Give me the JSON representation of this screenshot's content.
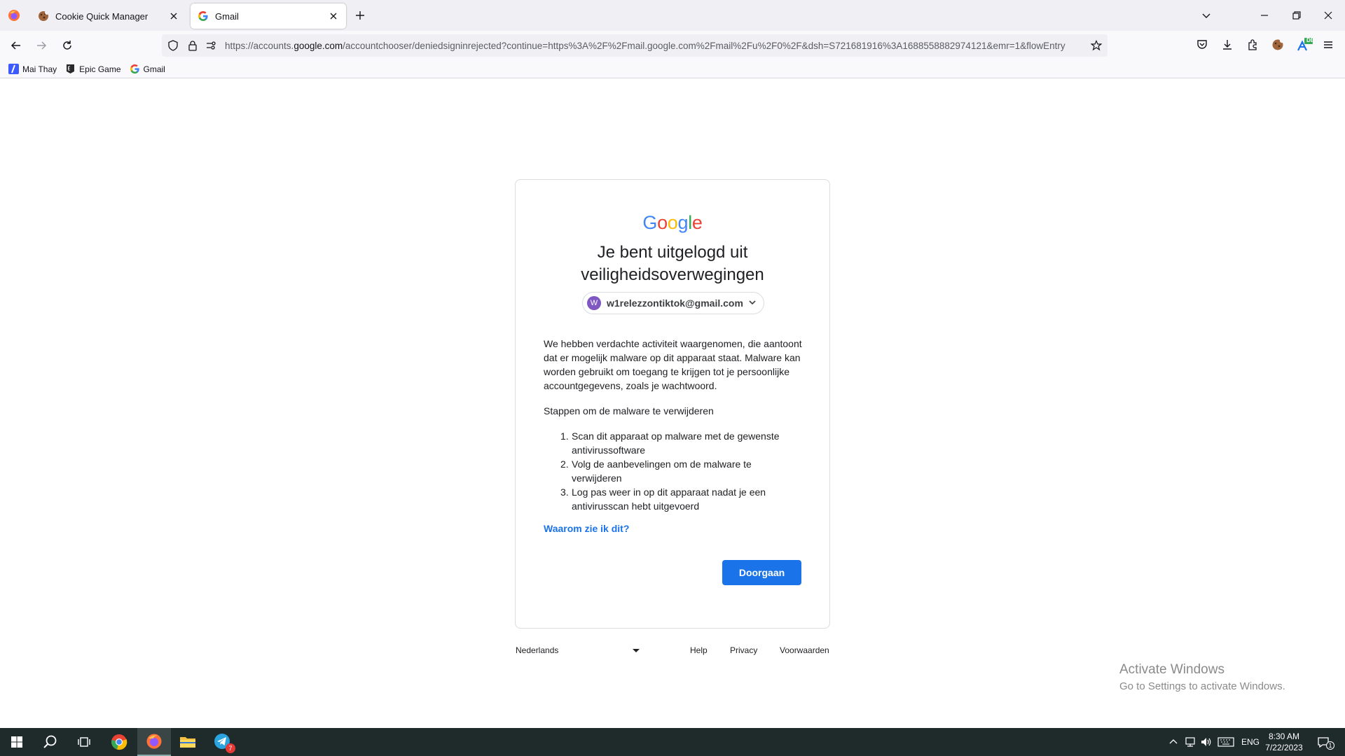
{
  "browser": {
    "tabs": [
      {
        "label": "Cookie Quick Manager",
        "active": false
      },
      {
        "label": "Gmail",
        "active": true
      }
    ],
    "url": {
      "prefix": "https://accounts.",
      "host": "google.com",
      "path": "/accountchooser/deniedsigninrejected?continue=https%3A%2F%2Fmail.google.com%2Fmail%2Fu%2F0%2F&dsh=S721681916%3A1688558882974121&emr=1&flowEntry"
    },
    "extension_badge": "DE",
    "bookmarks": [
      {
        "label": "Mai Thay",
        "icon": "mai-thay-icon"
      },
      {
        "label": "Epic Game",
        "icon": "epic-games-icon"
      },
      {
        "label": "Gmail",
        "icon": "google-g-icon"
      }
    ]
  },
  "page": {
    "logo_text": "Google",
    "heading_line1": "Je bent uitgelogd uit",
    "heading_line2": "veiligheidsoverwegingen",
    "account": {
      "avatar_letter": "W",
      "email": "w1relezzontiktok@gmail.com"
    },
    "body_text": "We hebben verdachte activiteit waargenomen, die aantoont dat er mogelijk malware op dit apparaat staat. Malware kan worden gebruikt om toegang te krijgen tot je persoonlijke accountgegevens, zoals je wachtwoord.",
    "steps_title": "Stappen om de malware te verwijderen",
    "steps": [
      {
        "num": "1.",
        "text": "Scan dit apparaat op malware met de gewenste antivirussoftware"
      },
      {
        "num": "2.",
        "text": "Volg de aanbevelingen om de malware te verwijderen"
      },
      {
        "num": "3.",
        "text": "Log pas weer in op dit apparaat nadat je een antivirusscan hebt uitgevoerd"
      }
    ],
    "why_link": "Waarom zie ik dit?",
    "continue_button": "Doorgaan",
    "footer": {
      "language": "Nederlands",
      "help": "Help",
      "privacy": "Privacy",
      "terms": "Voorwaarden"
    }
  },
  "watermark": {
    "line1": "Activate Windows",
    "line2": "Go to Settings to activate Windows."
  },
  "taskbar": {
    "telegram_badge": "7",
    "language": "ENG",
    "time": "8:30 AM",
    "date": "7/22/2023",
    "notification_count": "1"
  },
  "colors": {
    "google_blue": "#4285F4",
    "google_red": "#EA4335",
    "google_yellow": "#FBBC05",
    "google_green": "#34A853",
    "button_blue": "#1a73e8",
    "avatar_purple": "#7e57c2"
  }
}
